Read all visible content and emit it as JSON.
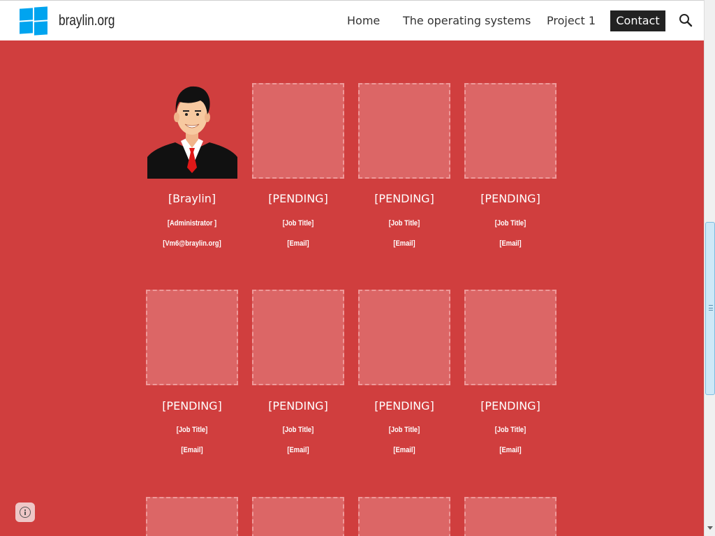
{
  "header": {
    "brand": "braylin.org",
    "nav": {
      "home": "Home",
      "operating_systems": "The operating systems",
      "project": "Project 1",
      "contact": "Contact"
    },
    "search_icon": "search-icon",
    "logo_icon": "windows-logo-icon",
    "colors": {
      "accent": "#00a4ef",
      "active_nav_bg": "#222222"
    }
  },
  "page": {
    "background": "#d03e3e"
  },
  "team_row_1": [
    {
      "name": "[Braylin]",
      "job": "[Administrator ]",
      "email": "[Vm6@braylin.org]",
      "has_photo": true
    },
    {
      "name": "[PENDING]",
      "job": "[Job Title]",
      "email": "[Email]",
      "has_photo": false
    },
    {
      "name": "[PENDING]",
      "job": "[Job Title]",
      "email": "[Email]",
      "has_photo": false
    },
    {
      "name": "[PENDING]",
      "job": "[Job Title]",
      "email": "[Email]",
      "has_photo": false
    }
  ],
  "team_row_2": [
    {
      "name": "[PENDING]",
      "job": "[Job Title]",
      "email": "[Email]",
      "has_photo": false
    },
    {
      "name": "[PENDING]",
      "job": "[Job Title]",
      "email": "[Email]",
      "has_photo": false
    },
    {
      "name": "[PENDING]",
      "job": "[Job Title]",
      "email": "[Email]",
      "has_photo": false
    },
    {
      "name": "[PENDING]",
      "job": "[Job Title]",
      "email": "[Email]",
      "has_photo": false
    }
  ],
  "info_icon": "info-icon"
}
